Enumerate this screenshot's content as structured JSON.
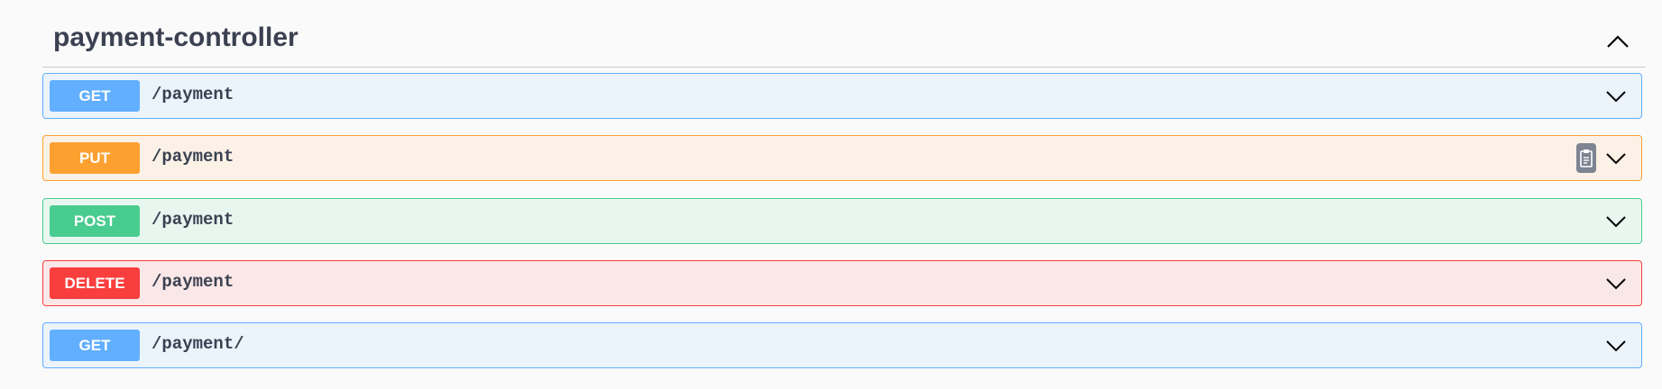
{
  "section": {
    "title": "payment-controller"
  },
  "operations": [
    {
      "method": "GET",
      "path": "/payment"
    },
    {
      "method": "PUT",
      "path": "/payment"
    },
    {
      "method": "POST",
      "path": "/payment"
    },
    {
      "method": "DELETE",
      "path": "/payment"
    },
    {
      "method": "GET",
      "path": "/payment/"
    }
  ],
  "icons": {
    "collapse": "chevron-up-icon",
    "expand": "chevron-down-icon",
    "copy": "copy-to-clipboard-icon"
  },
  "colors": {
    "get": "#61affe",
    "put": "#fca130",
    "post": "#49cc90",
    "delete": "#f93e3e",
    "text": "#3b4151"
  }
}
